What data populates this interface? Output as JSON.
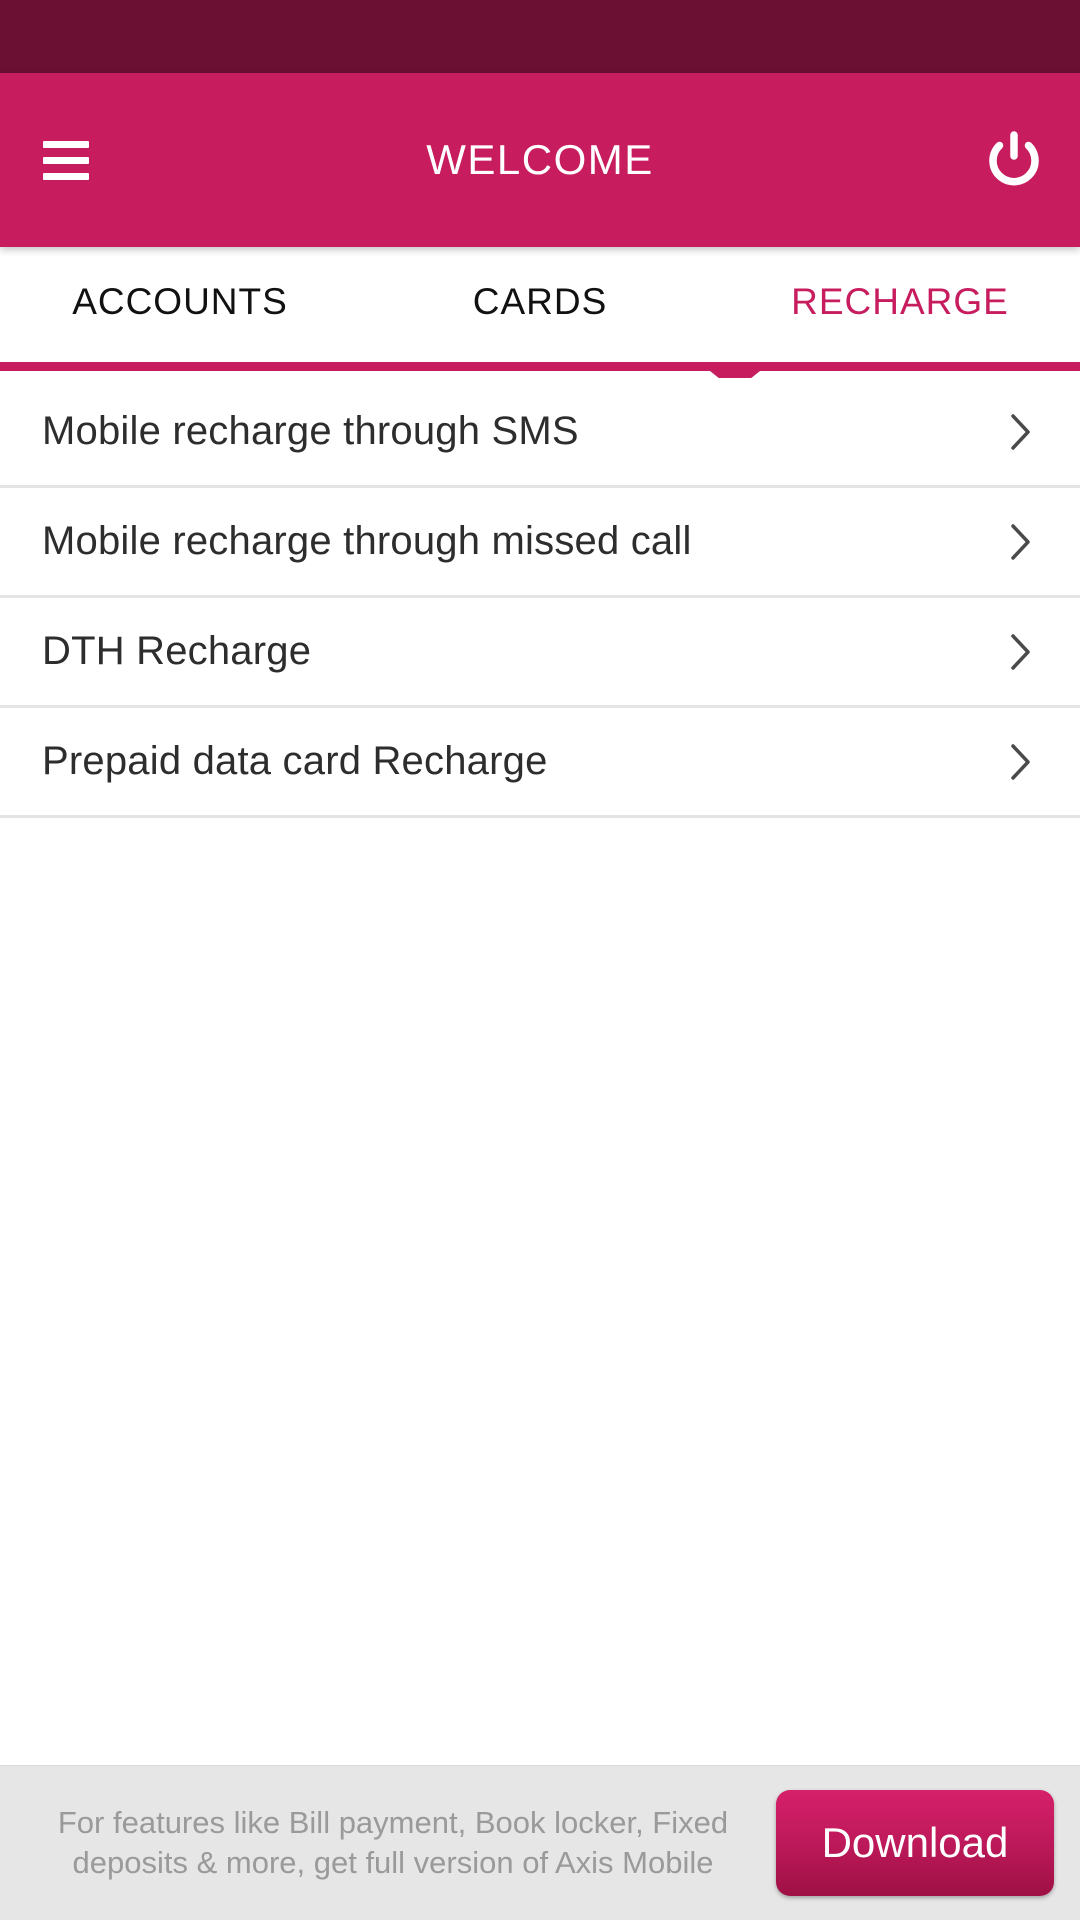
{
  "status_bar": {
    "background_color": "#6B0F33"
  },
  "header": {
    "title": "WELCOME",
    "background_color": "#C71C5E",
    "menu_icon": "hamburger-icon",
    "power_icon": "power-icon"
  },
  "tabs": {
    "items": [
      {
        "label": "ACCOUNTS",
        "active": false
      },
      {
        "label": "CARDS",
        "active": false
      },
      {
        "label": "RECHARGE",
        "active": true
      }
    ],
    "active_color": "#C71C5E",
    "inactive_color": "#111111"
  },
  "menu": {
    "items": [
      {
        "label": "Mobile recharge through SMS",
        "chevron": "chevron-right-icon"
      },
      {
        "label": "Mobile recharge through missed call",
        "chevron": "chevron-right-icon"
      },
      {
        "label": "DTH Recharge",
        "chevron": "chevron-right-icon"
      },
      {
        "label": "Prepaid data card Recharge",
        "chevron": "chevron-right-icon"
      }
    ]
  },
  "promo": {
    "text": "For features like Bill payment, Book locker, Fixed deposits & more, get full version of Axis Mobile",
    "download_label": "Download",
    "background_color": "#E6E6E6",
    "text_color": "#9A9A9A"
  }
}
